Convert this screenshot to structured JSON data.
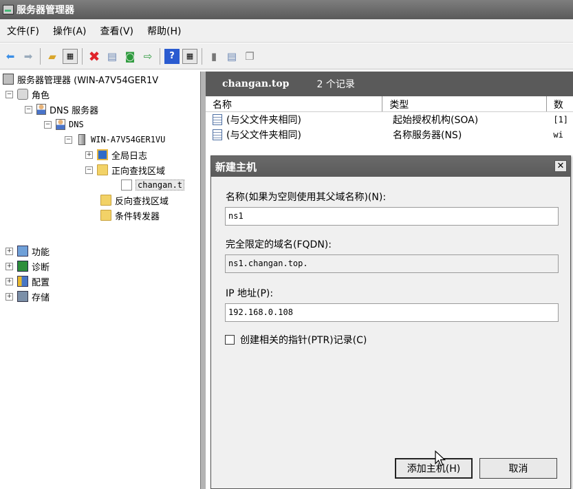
{
  "window": {
    "title": "服务器管理器"
  },
  "menu": [
    "文件(F)",
    "操作(A)",
    "查看(V)",
    "帮助(H)"
  ],
  "toolbar": {
    "back": "back-arrow-icon",
    "forward": "forward-arrow-icon",
    "up": "folder-up-icon",
    "show_hide": "show-hide-tree-icon",
    "delete": "delete-icon",
    "properties": "properties-icon",
    "refresh": "refresh-icon",
    "export": "export-icon",
    "help": "help-icon",
    "view": "view-icon",
    "colors": {
      "back": "#3a8ee6",
      "delete": "#e0242b",
      "help": "#2a5bd0"
    }
  },
  "tree": {
    "root": "服务器管理器 (WIN-A7V54GER1V",
    "roles": "角色",
    "dns_server": "DNS 服务器",
    "dns": "DNS",
    "server": "WIN-A7V54GER1VU",
    "global_logs": "全局日志",
    "forward_zones": "正向查找区域",
    "zone": "changan.t",
    "reverse_zones": "反向查找区域",
    "conditional": "条件转发器",
    "features": "功能",
    "diagnostics": "诊断",
    "configuration": "配置",
    "storage": "存储"
  },
  "panel": {
    "zone": "changan.top",
    "count": "2 个记录",
    "columns": [
      "名称",
      "类型",
      "数"
    ],
    "rows": [
      {
        "name": "(与父文件夹相同)",
        "type": "起始授权机构(SOA)",
        "data": "[1]"
      },
      {
        "name": "(与父文件夹相同)",
        "type": "名称服务器(NS)",
        "data": "wi"
      }
    ]
  },
  "dialog": {
    "title": "新建主机",
    "close": "✕",
    "name_label": "名称(如果为空则使用其父域名称)(N):",
    "name_value": "ns1",
    "fqdn_label": "完全限定的域名(FQDN):",
    "fqdn_value": "ns1.changan.top.",
    "ip_label": "IP 地址(P):",
    "ip_value": "192.168.0.108",
    "ptr_label": "创建相关的指针(PTR)记录(C)",
    "ptr_checked": false,
    "add_button": "添加主机(H)",
    "cancel_button": "取消"
  }
}
